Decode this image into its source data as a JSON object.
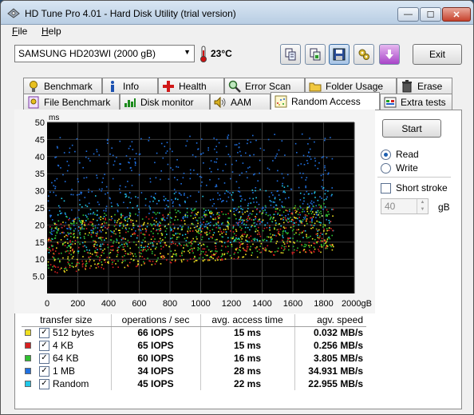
{
  "window": {
    "title": "HD Tune Pro 4.01 - Hard Disk Utility (trial version)",
    "controls": {
      "minimize": "—",
      "maximize": "☐",
      "close": "✕"
    }
  },
  "menu": [
    {
      "label": "File",
      "accesskey": "F",
      "rest": "ile"
    },
    {
      "label": "Help",
      "accesskey": "H",
      "rest": "elp"
    }
  ],
  "toolbar": {
    "drive": "SAMSUNG HD203WI (2000 gB)",
    "temperature": "23°C",
    "buttons": [
      "copy-info-icon",
      "copy-screenshot-icon",
      "save-icon",
      "options-icon",
      "download-icon"
    ],
    "exit_label": "Exit"
  },
  "tabs_row1": [
    {
      "label": "Benchmark",
      "icon": "benchmark-icon"
    },
    {
      "label": "Info",
      "icon": "info-icon"
    },
    {
      "label": "Health",
      "icon": "health-icon"
    },
    {
      "label": "Error Scan",
      "icon": "magnifier-icon"
    },
    {
      "label": "Folder Usage",
      "icon": "folder-icon"
    },
    {
      "label": "Erase",
      "icon": "trash-icon"
    }
  ],
  "tabs_row2": [
    {
      "label": "File Benchmark",
      "icon": "file-benchmark-icon"
    },
    {
      "label": "Disk monitor",
      "icon": "disk-monitor-icon"
    },
    {
      "label": "AAM",
      "icon": "speaker-icon"
    },
    {
      "label": "Random Access",
      "icon": "random-access-icon",
      "selected": true
    },
    {
      "label": "Extra tests",
      "icon": "extra-tests-icon"
    }
  ],
  "controls": {
    "start_label": "Start",
    "read_label": "Read",
    "write_label": "Write",
    "mode": "Read",
    "short_stroke_label": "Short stroke",
    "short_stroke_checked": false,
    "short_stroke_value": "40",
    "short_stroke_unit": "gB"
  },
  "chart_data": {
    "type": "scatter",
    "title": "",
    "y_unit_label": "ms",
    "x_unit_suffix": "gB",
    "xlim": [
      0,
      2000
    ],
    "ylim": [
      0,
      50
    ],
    "x_ticks": [
      "0",
      "200",
      "400",
      "600",
      "800",
      "1000",
      "1200",
      "1400",
      "1600",
      "1800",
      "2000gB"
    ],
    "y_ticks": [
      "5.0",
      "10",
      "15",
      "20",
      "25",
      "30",
      "35",
      "40",
      "45",
      "50"
    ],
    "grid": true,
    "background": "#000000",
    "series": [
      {
        "name": "512 bytes",
        "color": "#f0e020",
        "x_range": [
          0,
          2000
        ],
        "y_min": [
          6,
          13
        ],
        "y_max": [
          22,
          26
        ],
        "count": 450
      },
      {
        "name": "4 KB",
        "color": "#d82020",
        "x_range": [
          0,
          2000
        ],
        "y_min": [
          6,
          13
        ],
        "y_max": [
          22,
          26
        ],
        "count": 380
      },
      {
        "name": "64 KB",
        "color": "#30c030",
        "x_range": [
          0,
          2000
        ],
        "y_min": [
          7,
          14
        ],
        "y_max": [
          23,
          27
        ],
        "count": 500
      },
      {
        "name": "1 MB",
        "color": "#2070e0",
        "x_range": [
          0,
          2000
        ],
        "y_min": [
          17,
          22
        ],
        "y_max": [
          46,
          47
        ],
        "count": 620
      },
      {
        "name": "Random",
        "color": "#20c8e8",
        "x_range": [
          0,
          2000
        ],
        "y_min": [
          12,
          17
        ],
        "y_max": [
          28,
          33
        ],
        "count": 260
      }
    ]
  },
  "results": {
    "headers": [
      "transfer size",
      "operations / sec",
      "avg. access time",
      "agv. speed"
    ],
    "rows": [
      {
        "label": "512 bytes",
        "color": "#f0e020",
        "checked": true,
        "ops": "66 IOPS",
        "access": "15 ms",
        "speed": "0.032 MB/s"
      },
      {
        "label": "4 KB",
        "color": "#d82020",
        "checked": true,
        "ops": "65 IOPS",
        "access": "15 ms",
        "speed": "0.256 MB/s"
      },
      {
        "label": "64 KB",
        "color": "#30c030",
        "checked": true,
        "ops": "60 IOPS",
        "access": "16 ms",
        "speed": "3.805 MB/s"
      },
      {
        "label": "1 MB",
        "color": "#2070e0",
        "checked": true,
        "ops": "34 IOPS",
        "access": "28 ms",
        "speed": "34.931 MB/s"
      },
      {
        "label": "Random",
        "color": "#20c8e8",
        "checked": true,
        "ops": "45 IOPS",
        "access": "22 ms",
        "speed": "22.955 MB/s"
      }
    ]
  }
}
